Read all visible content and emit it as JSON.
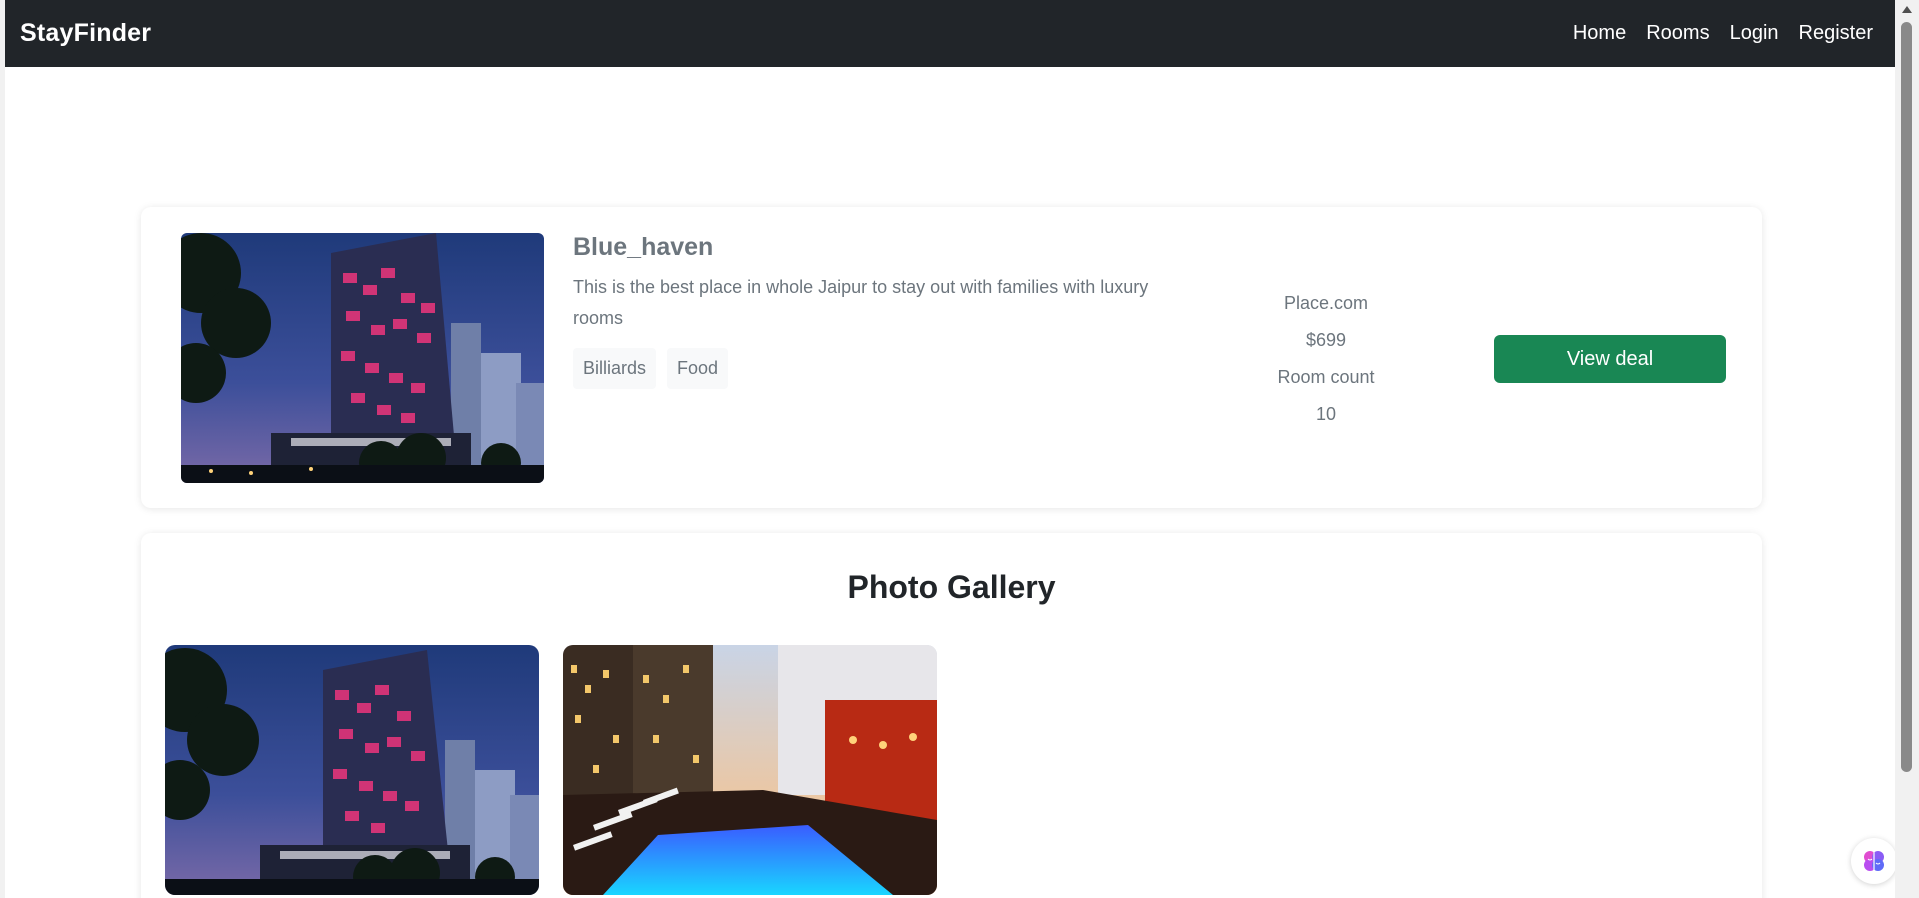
{
  "navbar": {
    "brand": "StayFinder",
    "links": [
      "Home",
      "Rooms",
      "Login",
      "Register"
    ]
  },
  "hotel": {
    "name": "Blue_haven",
    "description": "This is the best place in whole Jaipur to stay out with families with luxury rooms",
    "tags": [
      "Billiards",
      "Food"
    ],
    "source": "Place.com",
    "price": "$699",
    "room_count_label": "Room count",
    "room_count": "10",
    "cta_label": "View deal"
  },
  "gallery": {
    "title": "Photo Gallery"
  },
  "icons": {
    "assistant": "brain-icon"
  },
  "colors": {
    "navbar_bg": "#212529",
    "cta_bg": "#198754",
    "muted_text": "#6c757d"
  }
}
